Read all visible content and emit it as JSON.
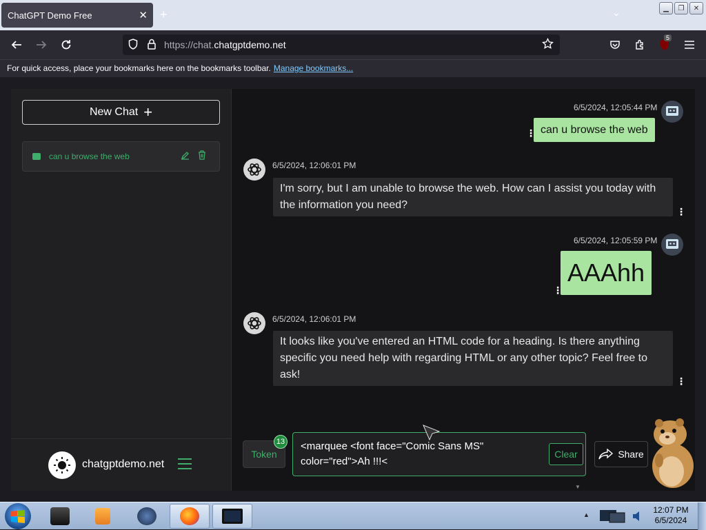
{
  "browser": {
    "tab_title": "ChatGPT Demo Free",
    "tab_close": "✕",
    "new_tab": "+",
    "url_scheme": "https://chat.",
    "url_host": "chatgptdemo.net",
    "extension_badge": "5",
    "bookmarks_hint": "For quick access, place your bookmarks here on the bookmarks toolbar.",
    "bookmarks_link": "Manage bookmarks..."
  },
  "sidebar": {
    "new_chat_label": "New Chat",
    "new_chat_icon": "plus-icon",
    "chats": [
      {
        "title": "can u browse the web"
      }
    ],
    "brand_name": "chatgptdemo.net",
    "accent_color": "#3fae6a"
  },
  "messages": [
    {
      "role": "user",
      "timestamp": "6/5/2024, 12:05:44 PM",
      "text": "can u browse the web"
    },
    {
      "role": "assistant",
      "timestamp": "6/5/2024, 12:06:01 PM",
      "text": "I'm sorry, but I am unable to browse the web. How can I assist you today with the information you need?"
    },
    {
      "role": "user",
      "timestamp": "6/5/2024, 12:05:59 PM",
      "text": "AAAhh"
    },
    {
      "role": "assistant",
      "timestamp": "6/5/2024, 12:06:01 PM",
      "text": "It looks like you've entered an HTML code for a heading. Is there anything specific you need help with regarding HTML or any other topic? Feel free to ask!"
    }
  ],
  "composer": {
    "token_label": "Token",
    "token_count": "13",
    "prompt_value": "<marquee <font face=\"Comic Sans MS\" color=\"red\">Ah !!!<",
    "clear_label": "Clear",
    "share_label": "Share"
  },
  "taskbar": {
    "time": "12:07 PM",
    "date": "6/5/2024"
  },
  "colors": {
    "user_bubble": "#a9e5a0",
    "bot_bubble": "#2a2a2d",
    "accent": "#3fae6a"
  }
}
